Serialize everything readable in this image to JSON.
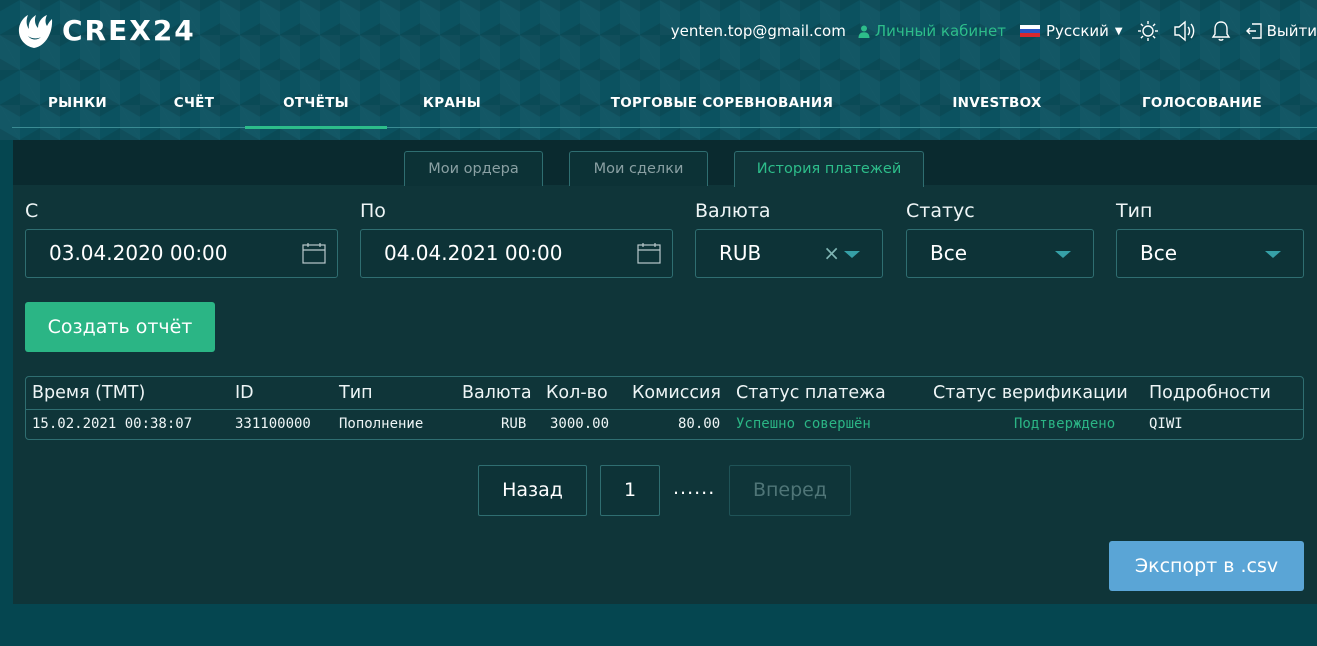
{
  "header": {
    "logo_text": "CREX24",
    "email": "yenten.top@gmail.com",
    "cabinet_label": "Личный кабинет",
    "language": "Русский",
    "logout_label": "Выйти",
    "brand_color": "#2dbd8a"
  },
  "nav": {
    "items": [
      "РЫНКИ",
      "СЧЁТ",
      "ОТЧЁТЫ",
      "КРАНЫ",
      "ТОРГОВЫЕ СОРЕВНОВАНИЯ",
      "INVESTBOX",
      "ГОЛОСОВАНИЕ"
    ],
    "active": "ОТЧЁТЫ"
  },
  "tabs": {
    "items": [
      "Мои ордера",
      "Мои сделки",
      "История платежей"
    ],
    "active": "История платежей"
  },
  "filters": {
    "from": {
      "label": "С",
      "value": "03.04.2020 00:00"
    },
    "to": {
      "label": "По",
      "value": "04.04.2021 00:00"
    },
    "currency": {
      "label": "Валюта",
      "value": "RUB",
      "clear": "×"
    },
    "status": {
      "label": "Статус",
      "value": "Все"
    },
    "type": {
      "label": "Тип",
      "value": "Все"
    }
  },
  "create_button": "Создать отчёт",
  "table": {
    "columns": [
      "Время (ТМТ)",
      "ID",
      "Тип",
      "Валюта",
      "Кол-во",
      "Комиссия",
      "Статус платежа",
      "Статус верификации",
      "Подробности"
    ],
    "rows": [
      {
        "time": "15.02.2021 00:38:07",
        "id": "331100000",
        "type": "Пополнение",
        "currency": "RUB",
        "amount": "3000.00",
        "fee": "80.00",
        "payment_status": "Успешно совершён",
        "verification_status": "Подтверждено",
        "details": "QIWI"
      }
    ]
  },
  "pagination": {
    "prev": "Назад",
    "page": "1",
    "dots": "......",
    "next": "Вперед"
  },
  "export_button": "Экспорт в .csv"
}
